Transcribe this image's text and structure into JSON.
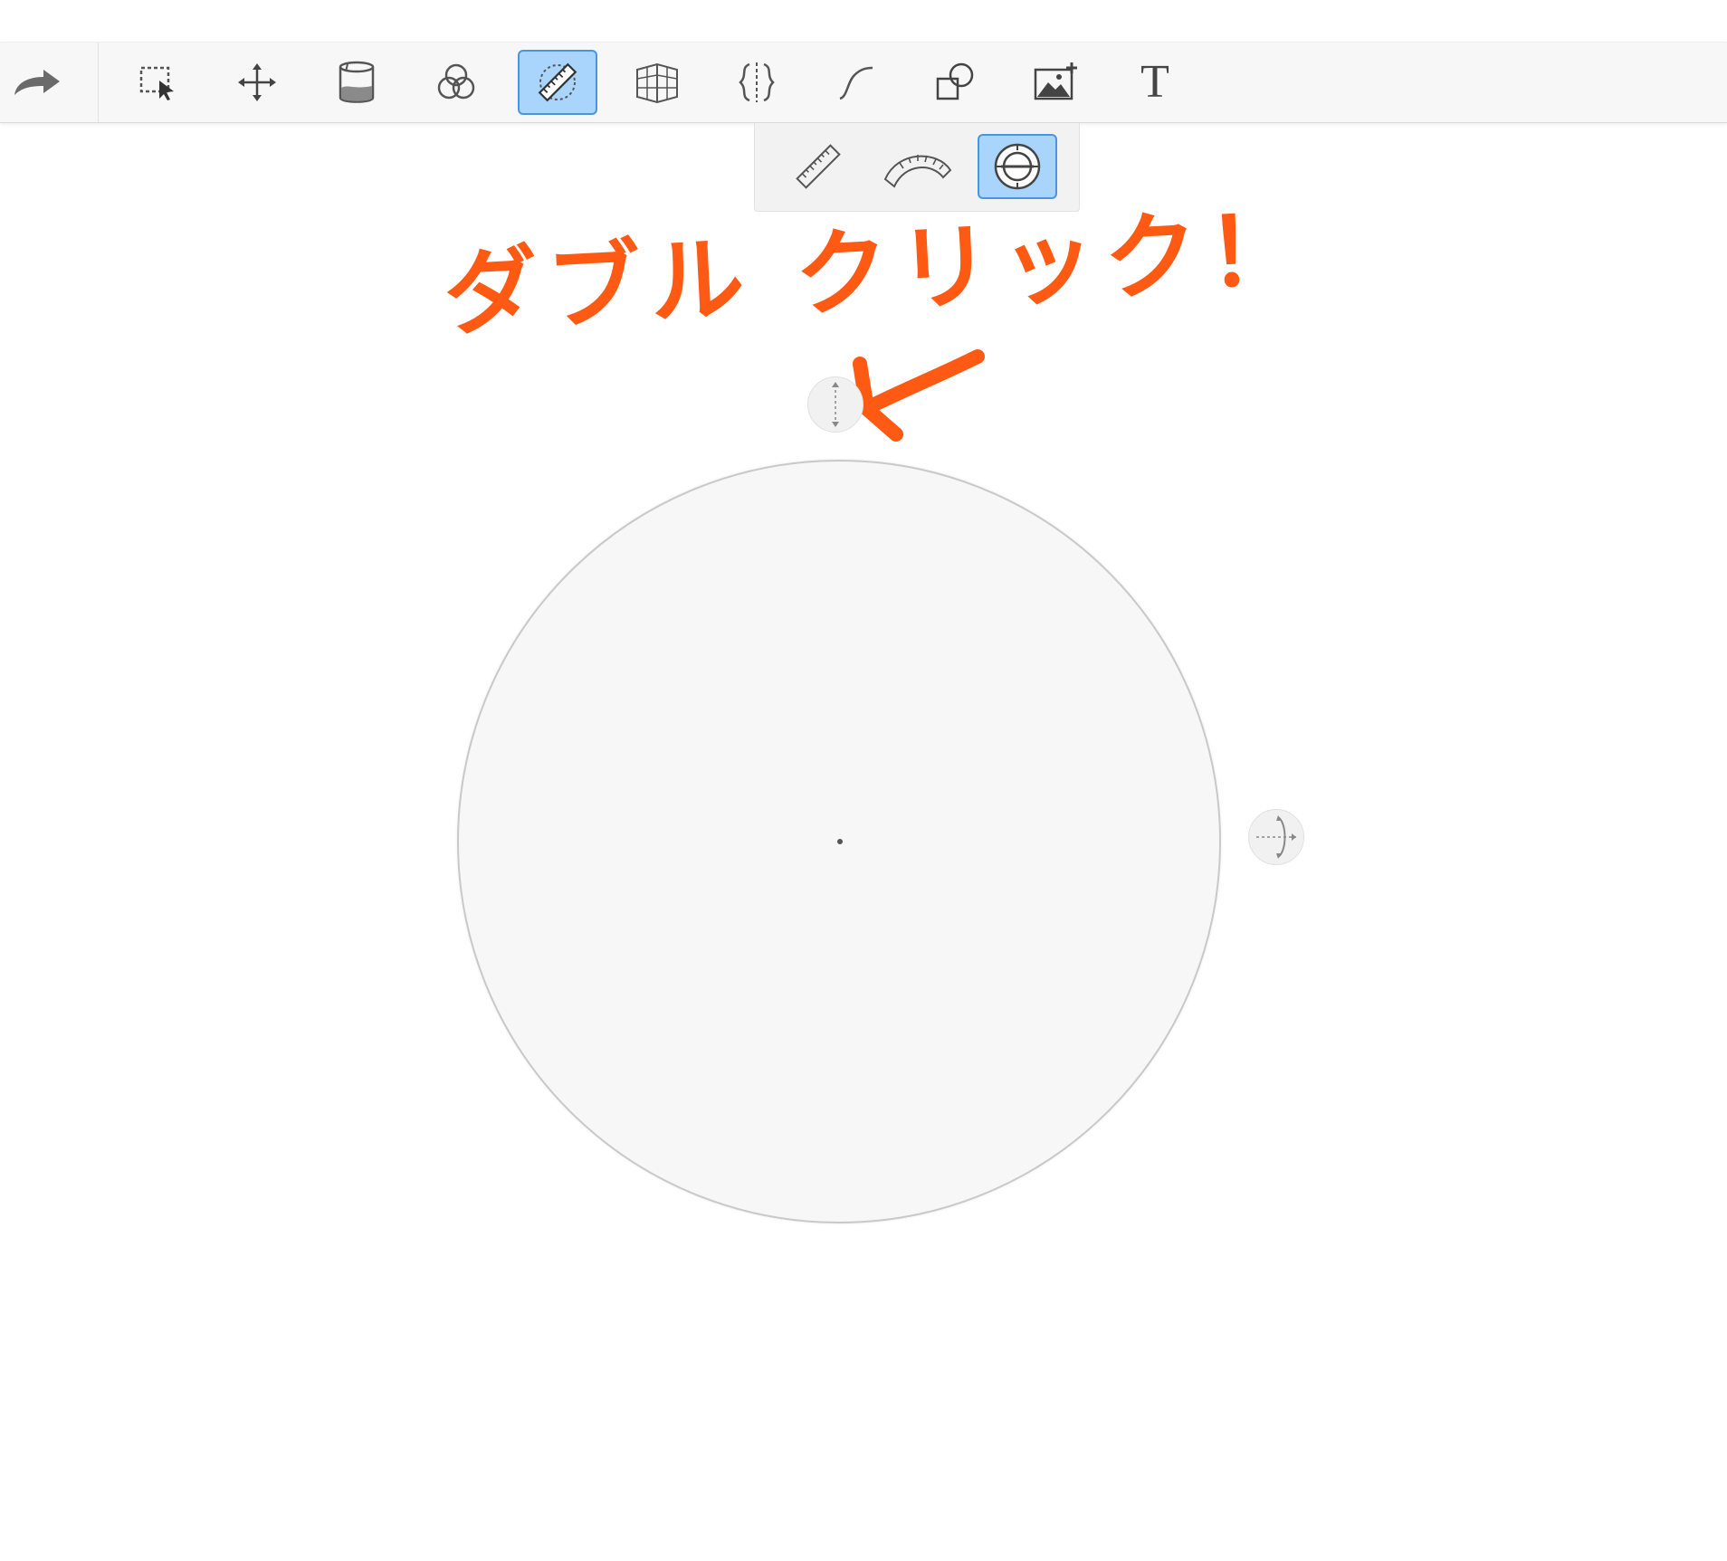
{
  "toolbar": {
    "tools": [
      {
        "name": "redo-icon"
      },
      {
        "name": "selection-tool-icon"
      },
      {
        "name": "move-tool-icon"
      },
      {
        "name": "fill-bucket-icon"
      },
      {
        "name": "blend-circles-icon"
      },
      {
        "name": "ruler-tool-icon",
        "active": true
      },
      {
        "name": "perspective-grid-icon"
      },
      {
        "name": "symmetry-icon"
      },
      {
        "name": "curve-icon"
      },
      {
        "name": "shapes-icon"
      },
      {
        "name": "insert-image-icon"
      },
      {
        "name": "text-tool-icon",
        "label": "T"
      }
    ]
  },
  "ruler_subpanel": {
    "options": [
      {
        "name": "straight-ruler-icon"
      },
      {
        "name": "arc-ruler-icon"
      },
      {
        "name": "circle-ruler-icon",
        "active": true
      }
    ]
  },
  "annotation": {
    "text": "ダブル クリック！",
    "color": "#ff5a14"
  },
  "colors": {
    "accent_active_bg": "#a9d4fb",
    "accent_active_border": "#4a95e0",
    "annotation_orange": "#ff5a14"
  }
}
